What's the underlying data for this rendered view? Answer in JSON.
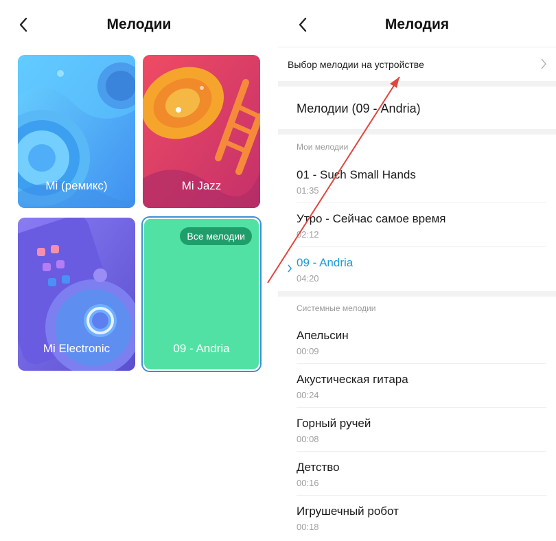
{
  "left": {
    "title": "Мелодии",
    "tiles": [
      {
        "label": "Mi (ремикс)"
      },
      {
        "label": "Mi Jazz"
      },
      {
        "label": "Mi Electronic"
      },
      {
        "label": "09 - Andria",
        "badge": "Все мелодии"
      }
    ]
  },
  "right": {
    "title": "Мелодия",
    "device_picker": "Выбор мелодии на устройстве",
    "current": "Мелодии (09 - Andria)",
    "my_header": "Мои мелодии",
    "my_items": [
      {
        "name": "01 - Such Small Hands",
        "duration": "01:35"
      },
      {
        "name": "Утро - Сейчас самое время",
        "duration": "02:12"
      },
      {
        "name": "09 - Andria",
        "duration": "04:20",
        "selected": true
      }
    ],
    "system_header": "Системные мелодии",
    "system_items": [
      {
        "name": "Апельсин",
        "duration": "00:09"
      },
      {
        "name": "Акустическая гитара",
        "duration": "00:24"
      },
      {
        "name": "Горный ручей",
        "duration": "00:08"
      },
      {
        "name": "Детство",
        "duration": "00:16"
      },
      {
        "name": "Игрушечный робот",
        "duration": "00:18"
      }
    ]
  },
  "colors": {
    "accent": "#1e9ad6",
    "tile_all": "#52e1a4",
    "badge": "#1f9e6b",
    "arrow": "#e0453c"
  }
}
